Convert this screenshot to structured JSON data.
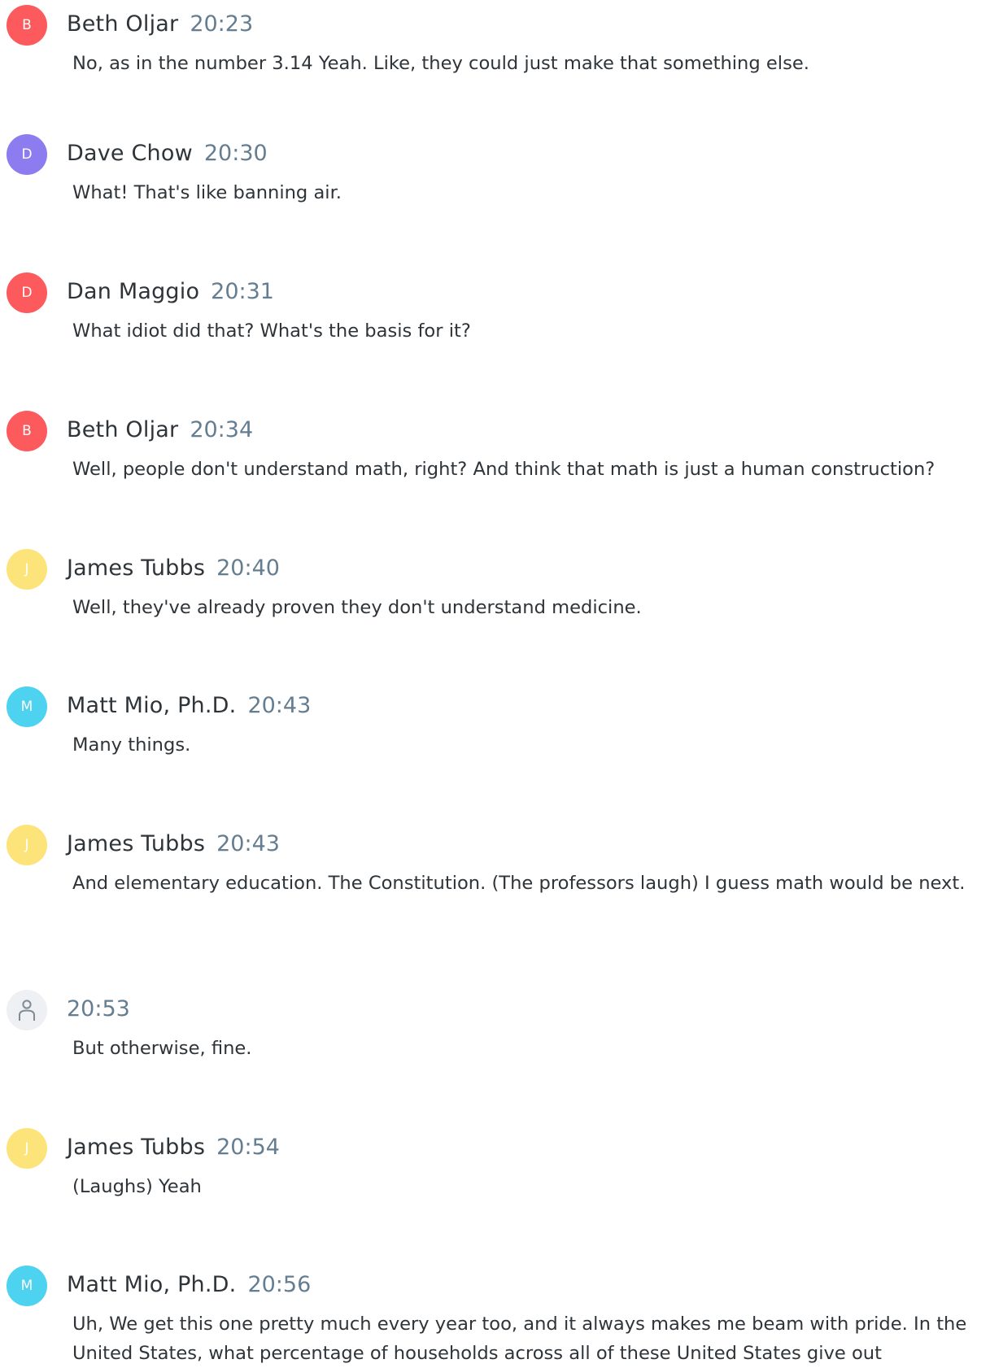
{
  "colors": {
    "avatar_red": "#fd5a5e",
    "avatar_purple": "#8c7cf0",
    "avatar_yellow": "#fde47a",
    "avatar_cyan": "#4dd2f0",
    "avatar_unknown_bg": "#eef0f3",
    "speaker_text": "#2f3439",
    "timestamp_text": "#647d91",
    "body_text": "#2f3439"
  },
  "messages": [
    {
      "initial": "B",
      "avatar_color": "#fd5a5e",
      "speaker": "Beth Oljar",
      "time": "20:23",
      "text": "No, as in the number 3.14 Yeah. Like, they could just make that something else."
    },
    {
      "initial": "D",
      "avatar_color": "#8c7cf0",
      "speaker": "Dave Chow",
      "time": "20:30",
      "text": "What! That's like banning air."
    },
    {
      "initial": "D",
      "avatar_color": "#fd5a5e",
      "speaker": "Dan Maggio",
      "time": "20:31",
      "text": "What idiot did that? What's the basis for it?"
    },
    {
      "initial": "B",
      "avatar_color": "#fd5a5e",
      "speaker": "Beth Oljar",
      "time": "20:34",
      "text": "Well, people don't understand math, right? And think that math is just a human construction?"
    },
    {
      "initial": "J",
      "avatar_color": "#fde47a",
      "speaker": "James Tubbs",
      "time": "20:40",
      "text": "Well, they've already proven they don't understand medicine."
    },
    {
      "initial": "M",
      "avatar_color": "#4dd2f0",
      "speaker": "Matt Mio, Ph.D.",
      "time": "20:43",
      "text": "Many things."
    },
    {
      "initial": "J",
      "avatar_color": "#fde47a",
      "speaker": "James Tubbs",
      "time": "20:43",
      "text": "And elementary education. The Constitution. (The professors laugh) I guess math would be next."
    },
    {
      "initial": "",
      "avatar_icon": "person-icon",
      "avatar_color": "#eef0f3",
      "speaker": "",
      "time": "20:53",
      "text": "But otherwise, fine."
    },
    {
      "initial": "J",
      "avatar_color": "#fde47a",
      "speaker": "James Tubbs",
      "time": "20:54",
      "text": "(Laughs) Yeah"
    },
    {
      "initial": "M",
      "avatar_color": "#4dd2f0",
      "speaker": "Matt Mio, Ph.D.",
      "time": "20:56",
      "text": "Uh, We get this one pretty much every year too, and it always makes me beam with pride. In the United States, what percentage of households across all of these United States give out"
    }
  ]
}
